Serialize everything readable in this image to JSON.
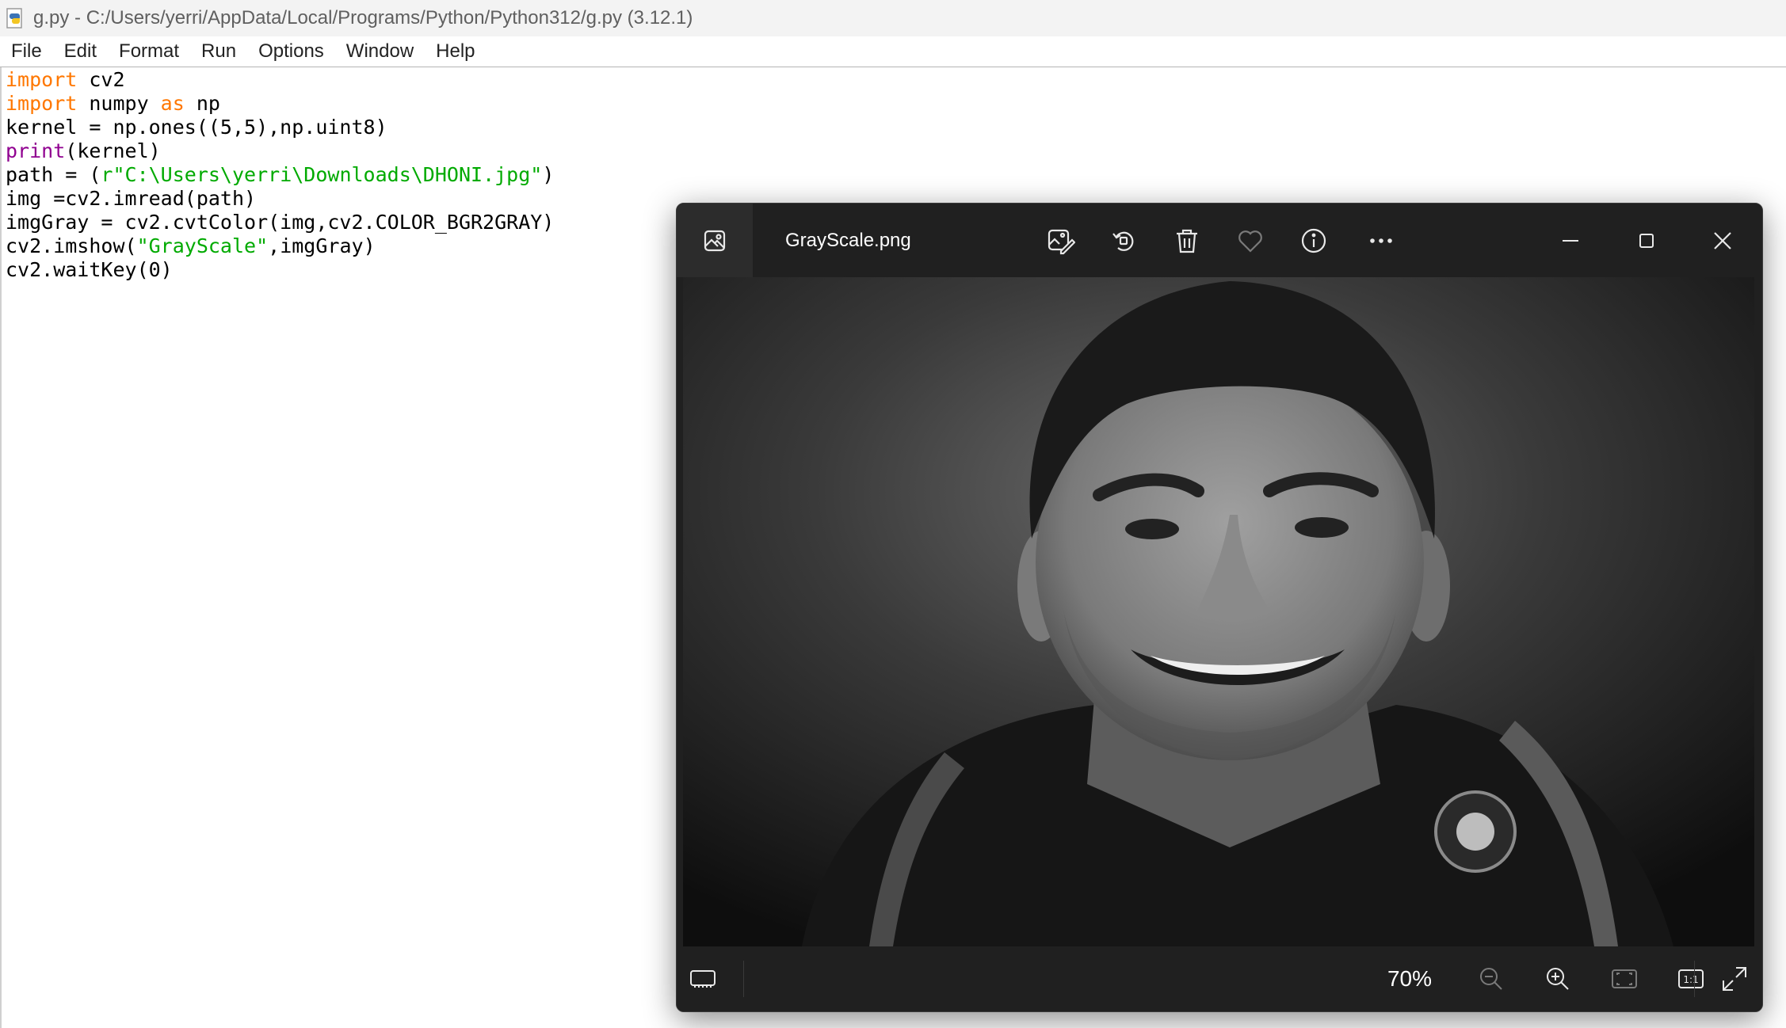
{
  "idle": {
    "title": "g.py - C:/Users/yerri/AppData/Local/Programs/Python/Python312/g.py (3.12.1)",
    "menu": [
      "File",
      "Edit",
      "Format",
      "Run",
      "Options",
      "Window",
      "Help"
    ],
    "code_lines": [
      [
        {
          "t": "import",
          "c": "kw"
        },
        {
          "t": " cv2",
          "c": ""
        }
      ],
      [
        {
          "t": "import",
          "c": "kw"
        },
        {
          "t": " numpy ",
          "c": ""
        },
        {
          "t": "as",
          "c": "kw"
        },
        {
          "t": " np",
          "c": ""
        }
      ],
      [
        {
          "t": "kernel = np.ones((5,5),np.uint8)",
          "c": ""
        }
      ],
      [
        {
          "t": "print",
          "c": "bi"
        },
        {
          "t": "(kernel)",
          "c": ""
        }
      ],
      [
        {
          "t": "path = (",
          "c": ""
        },
        {
          "t": "r\"C:\\Users\\yerri\\Downloads\\DHONI.jpg\"",
          "c": "st"
        },
        {
          "t": ")",
          "c": ""
        }
      ],
      [
        {
          "t": "img =cv2.imread(path)",
          "c": ""
        }
      ],
      [
        {
          "t": "imgGray = cv2.cvtColor(img,cv2.COLOR_BGR2GRAY)",
          "c": ""
        }
      ],
      [
        {
          "t": "cv2.imshow(",
          "c": ""
        },
        {
          "t": "\"GrayScale\"",
          "c": "st"
        },
        {
          "t": ",imgGray)",
          "c": ""
        }
      ],
      [
        {
          "t": "cv2.waitKey(0)",
          "c": ""
        }
      ]
    ],
    "colors": {
      "keyword": "#ff7700",
      "builtin": "#900090",
      "string": "#00aa00"
    }
  },
  "viewer": {
    "filename": "GrayScale.png",
    "zoom": "70%",
    "toolbar_icons": [
      "edit-image-icon",
      "rotate-icon",
      "delete-icon",
      "favorite-heart-icon",
      "info-icon",
      "more-options-icon"
    ],
    "window_controls": [
      "minimize-icon",
      "maximize-icon",
      "close-icon"
    ],
    "bottom_icons": [
      "filmstrip-icon",
      "zoom-out-icon",
      "zoom-in-icon",
      "fit-to-window-icon",
      "actual-size-icon",
      "fullscreen-icon"
    ]
  }
}
